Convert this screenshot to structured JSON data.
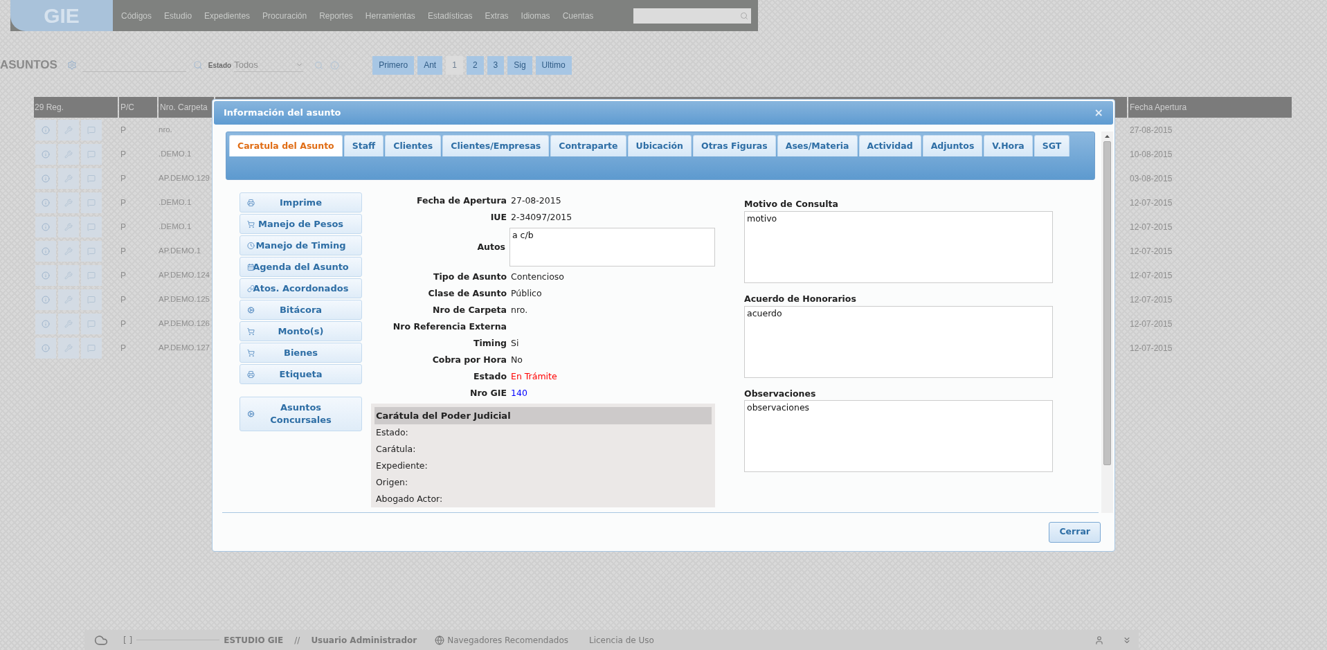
{
  "nav": {
    "logo": "GIE",
    "menu": [
      "Códigos",
      "Estudio",
      "Expedientes",
      "Procuración",
      "Reportes",
      "Herramientas",
      "Estadísticas",
      "Extras",
      "Idiomas",
      "Cuentas"
    ]
  },
  "toolbar": {
    "title": "ASUNTOS",
    "estado_label": "Estado",
    "estado_value": "Todos",
    "pages": [
      {
        "label": "Primero",
        "selected": false
      },
      {
        "label": "Ant",
        "selected": false
      },
      {
        "label": "1",
        "selected": true
      },
      {
        "label": "2",
        "selected": false
      },
      {
        "label": "3",
        "selected": false
      },
      {
        "label": "Sig",
        "selected": false
      },
      {
        "label": "Ultimo",
        "selected": false
      }
    ]
  },
  "table": {
    "columns": [
      "29 Reg.",
      "P/C",
      "Nro. Carpeta",
      "Fecha Apertura"
    ],
    "rows": [
      {
        "pc": "P",
        "carpeta": "nro.",
        "fecha": "27-08-2015"
      },
      {
        "pc": "P",
        "carpeta": ".DEMO.1",
        "fecha": "10-08-2015"
      },
      {
        "pc": "P",
        "carpeta": "AP.DEMO.129",
        "fecha": "03-08-2015"
      },
      {
        "pc": "P",
        "carpeta": ".DEMO.1",
        "fecha": "12-07-2015"
      },
      {
        "pc": "P",
        "carpeta": ".DEMO.1",
        "fecha": "12-07-2015"
      },
      {
        "pc": "P",
        "carpeta": "AP.DEMO.1",
        "fecha": "12-07-2015"
      },
      {
        "pc": "P",
        "carpeta": "AP.DEMO.124",
        "fecha": "12-07-2015"
      },
      {
        "pc": "P",
        "carpeta": "AP.DEMO.125",
        "fecha": "12-07-2015"
      },
      {
        "pc": "P",
        "carpeta": "AP.DEMO.126",
        "fecha": "12-07-2015"
      },
      {
        "pc": "P",
        "carpeta": "AP.DEMO.127",
        "fecha": "12-07-2015"
      }
    ]
  },
  "modal": {
    "title": "Información del asunto",
    "close": "×",
    "tabs": [
      {
        "label": "Caratula del Asunto",
        "selected": true
      },
      {
        "label": "Staff",
        "selected": false
      },
      {
        "label": "Clientes",
        "selected": false
      },
      {
        "label": "Clientes/Empresas",
        "selected": false
      },
      {
        "label": "Contraparte",
        "selected": false
      },
      {
        "label": "Ubicación",
        "selected": false
      },
      {
        "label": "Otras Figuras",
        "selected": false
      },
      {
        "label": "Ases/Materia",
        "selected": false
      },
      {
        "label": "Actividad",
        "selected": false
      },
      {
        "label": "Adjuntos",
        "selected": false
      },
      {
        "label": "V.Hora",
        "selected": false
      },
      {
        "label": "SGT",
        "selected": false
      }
    ],
    "actions": [
      {
        "label": "Imprime",
        "kind": "print"
      },
      {
        "label": "Manejo de Pesos",
        "kind": "money"
      },
      {
        "label": "Manejo de Timing",
        "kind": "timing"
      },
      {
        "label": "Agenda del Asunto",
        "kind": "agenda"
      },
      {
        "label": "Atos. Acordonados",
        "kind": "linked"
      },
      {
        "label": "Bitácora",
        "kind": "log"
      },
      {
        "label": "Monto(s)",
        "kind": "money"
      },
      {
        "label": "Bienes",
        "kind": "money"
      },
      {
        "label": "Etiqueta",
        "kind": "print"
      },
      {
        "label": "Asuntos Concursales",
        "kind": "log"
      }
    ],
    "fields": [
      {
        "label": "Fecha de Apertura",
        "value": "27-08-2015",
        "kind": "text"
      },
      {
        "label": "IUE",
        "value": "2-34097/2015",
        "kind": "text"
      },
      {
        "label": "Autos",
        "value": "a c/b",
        "kind": "textarea"
      },
      {
        "label": "Tipo de Asunto",
        "value": "Contencioso",
        "kind": "text"
      },
      {
        "label": "Clase de Asunto",
        "value": "Público",
        "kind": "text"
      },
      {
        "label": "Nro de Carpeta",
        "value": "nro.",
        "kind": "text"
      },
      {
        "label": "Nro Referencia Externa",
        "kind": "text"
      },
      {
        "label": "Timing",
        "value": "Si",
        "kind": "text"
      },
      {
        "label": "Cobra por Hora",
        "value": "No",
        "kind": "text"
      },
      {
        "label": "Estado",
        "value": "En Trámite",
        "kind": "text",
        "color": "#ff0000"
      },
      {
        "label": "Nro GIE",
        "value": "140",
        "kind": "text",
        "color": "#0000ff"
      }
    ],
    "poder_judicial": {
      "title": "Carátula del Poder Judicial",
      "items": [
        "Estado:",
        "Carátula:",
        "Expediente:",
        "Origen:",
        "Abogado Actor:"
      ]
    },
    "notes": [
      {
        "label": "Motivo de Consulta",
        "value": "motivo"
      },
      {
        "label": "Acuerdo de Honorarios",
        "value": "acuerdo"
      },
      {
        "label": "Observaciones",
        "value": "observaciones"
      }
    ],
    "close_button": "Cerrar"
  },
  "status_bar": {
    "bracket": "[ ]",
    "studio": "ESTUDIO GIE",
    "separator": "//",
    "user": "Usuario Administrador",
    "browsers": "Navegadores Recomendados",
    "license": "Licencia de Uso"
  }
}
